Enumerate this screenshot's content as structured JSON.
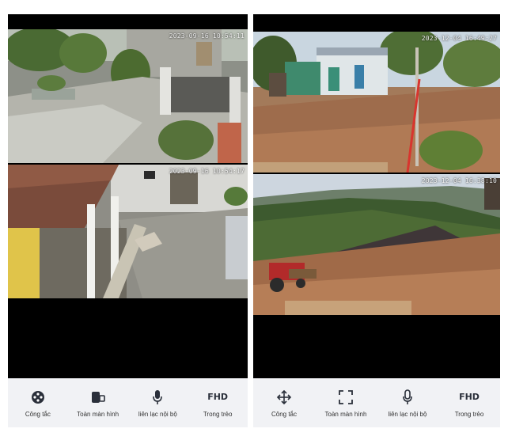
{
  "left_phone": {
    "cameras": [
      {
        "timestamp": "2023-09-16 10:54:11"
      },
      {
        "timestamp": "2023-09-16 10:54:17"
      }
    ],
    "toolbar": [
      {
        "icon": "power-switch-icon",
        "label": "Công tắc"
      },
      {
        "icon": "fullscreen-phone-icon",
        "label": "Toàn màn hình"
      },
      {
        "icon": "microphone-icon",
        "label": "liên lạc nội bộ"
      },
      {
        "icon": "fhd-text-icon",
        "text": "FHD",
        "label": "Trong trẻo"
      }
    ]
  },
  "right_phone": {
    "cameras": [
      {
        "timestamp": "2023-12-04 16:49:27"
      },
      {
        "timestamp": "2023-12-04 16:38:10"
      }
    ],
    "toolbar": [
      {
        "icon": "move-arrows-icon",
        "label": "Công tắc"
      },
      {
        "icon": "fullscreen-corners-icon",
        "label": "Toàn màn hình"
      },
      {
        "icon": "microphone-icon",
        "label": "liên lạc nội bộ"
      },
      {
        "icon": "fhd-text-icon",
        "text": "FHD",
        "label": "Trong trẻo"
      }
    ]
  }
}
